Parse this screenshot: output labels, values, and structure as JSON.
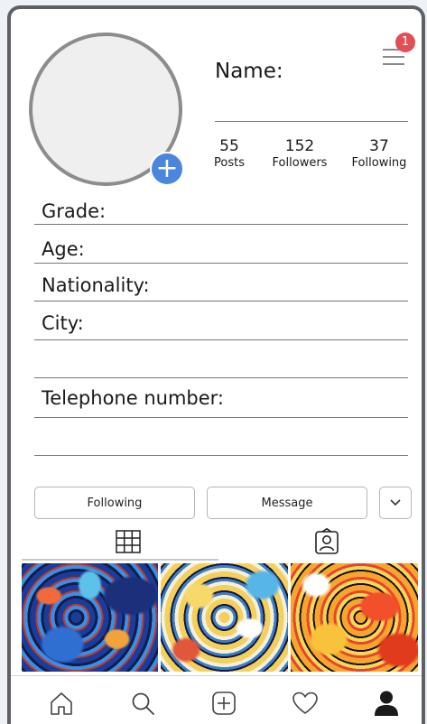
{
  "profile": {
    "name_label": "Name:",
    "notification_count": "1",
    "stats": [
      {
        "number": "55",
        "label": "Posts"
      },
      {
        "number": "152",
        "label": "Followers"
      },
      {
        "number": "37",
        "label": "Following"
      }
    ]
  },
  "fields": {
    "grade": "Grade:",
    "age": "Age:",
    "nationality": "Nationality:",
    "city": "City:",
    "blank1": "",
    "telephone": "Telephone number:",
    "blank2": ""
  },
  "actions": {
    "following": "Following",
    "message": "Message"
  },
  "icons": {
    "add_photo": "plus-icon",
    "menu": "hamburger-icon",
    "grid": "grid-icon",
    "tagged": "tagged-person-icon",
    "dropdown": "chevron-down-icon",
    "nav": [
      "home-icon",
      "search-icon",
      "add-icon",
      "heart-icon",
      "profile-icon"
    ]
  },
  "colors": {
    "accent_blue": "#4a86dd",
    "badge_red": "#e24e55",
    "frame": "#5d6166"
  }
}
